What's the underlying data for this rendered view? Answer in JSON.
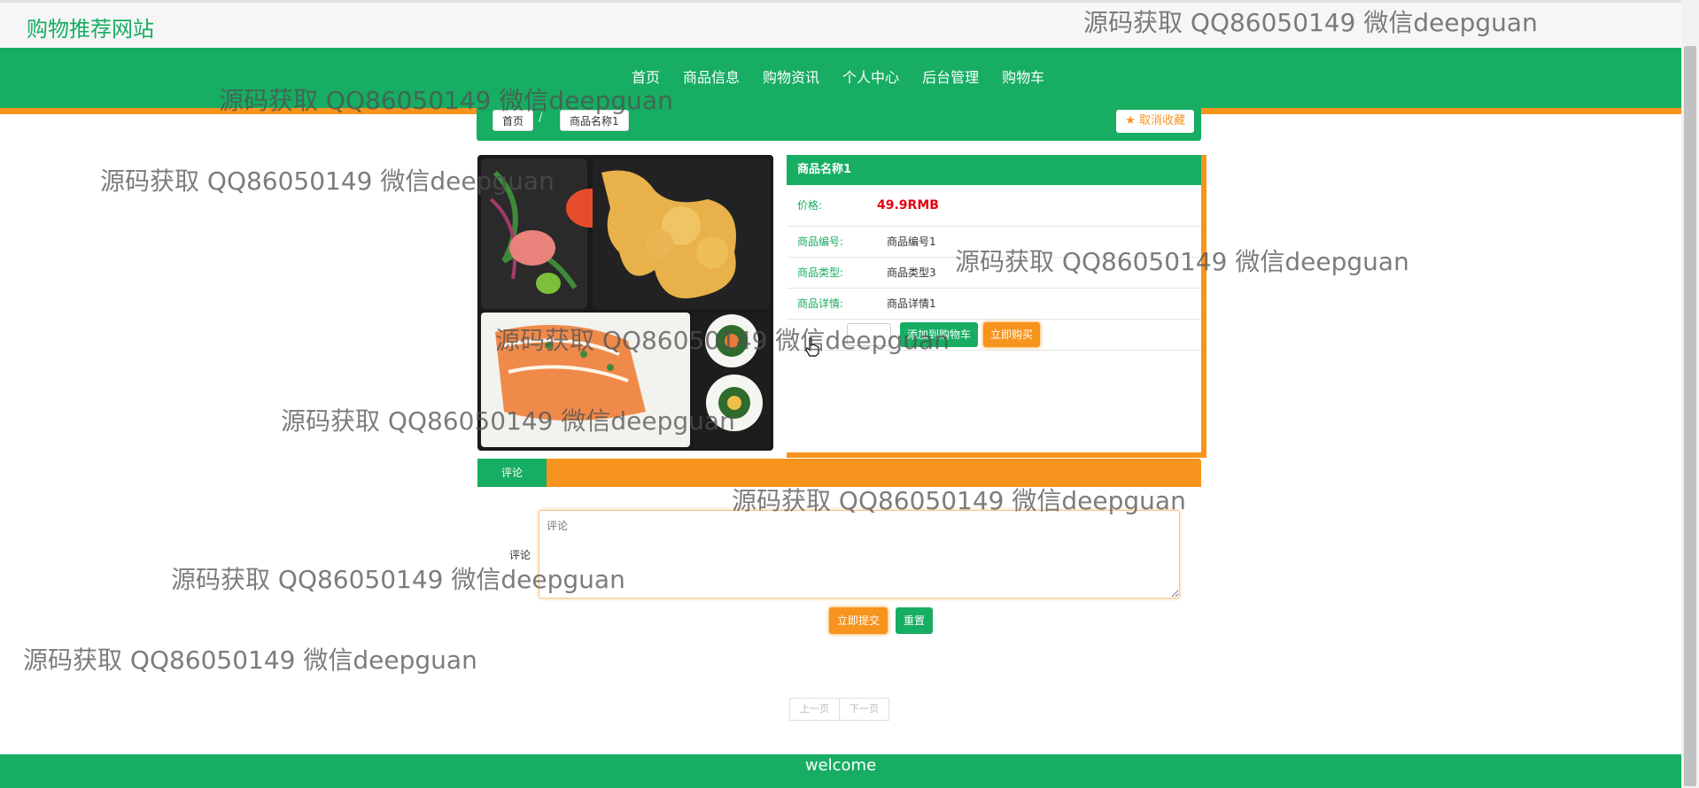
{
  "header": {
    "site_title": "购物推荐网站"
  },
  "nav": {
    "items": [
      {
        "label": "首页"
      },
      {
        "label": "商品信息"
      },
      {
        "label": "购物资讯"
      },
      {
        "label": "个人中心"
      },
      {
        "label": "后台管理"
      },
      {
        "label": "购物车"
      }
    ]
  },
  "breadcrumb": {
    "home": "首页",
    "separator": "/",
    "current": "商品名称1",
    "favorite_label": "★ 取消收藏"
  },
  "product": {
    "name": "商品名称1",
    "price_label": "价格:",
    "price": "49.9RMB",
    "fields": [
      {
        "label": "商品编号:",
        "value": "商品编号1"
      },
      {
        "label": "商品类型:",
        "value": "商品类型3"
      },
      {
        "label": "商品详情:",
        "value": "商品详情1"
      }
    ],
    "add_to_cart_label": "添加到购物车",
    "buy_now_label": "立即购买"
  },
  "comment": {
    "tab_label": "评论",
    "field_label": "评论",
    "placeholder": "评论",
    "submit_label": "立即提交",
    "reset_label": "重置"
  },
  "pager": {
    "prev": "上一页",
    "next": "下一页"
  },
  "footer": {
    "text": "welcome"
  },
  "watermark": "源码获取 QQ86050149 微信deepguan",
  "colors": {
    "primary": "#17ad62",
    "accent": "#f7941d",
    "price": "#e60012"
  }
}
